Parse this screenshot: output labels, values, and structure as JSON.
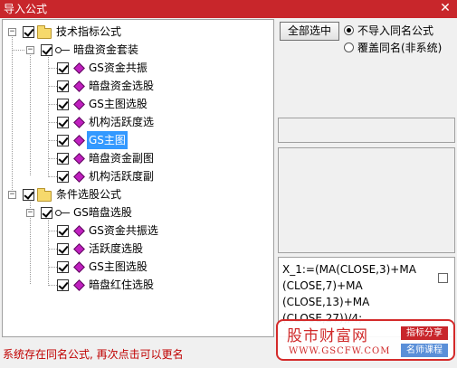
{
  "window": {
    "title": "导入公式",
    "close_glyph": "✕"
  },
  "tree": {
    "groups": [
      {
        "label": "技术指标公式",
        "expander": "−",
        "sets": [
          {
            "label": "暗盘资金套装",
            "expander": "−",
            "items": [
              "GS资金共振",
              "暗盘资金选股",
              "GS主图选股",
              "机构活跃度选",
              "GS主图",
              "暗盘资金副图",
              "机构活跃度副"
            ]
          }
        ]
      },
      {
        "label": "条件选股公式",
        "expander": "−",
        "sets": [
          {
            "label": "GS暗盘选股",
            "expander": "−",
            "items": [
              "GS资金共振选",
              "活跃度选股",
              "GS主图选股",
              "暗盘红住选股"
            ]
          }
        ]
      }
    ],
    "selected_item": "GS主图"
  },
  "controls": {
    "select_all_label": "全部选中",
    "radio_options": [
      {
        "label": "不导入同名公式",
        "checked": true
      },
      {
        "label": "覆盖同名(非系统)",
        "checked": false
      }
    ]
  },
  "formula_text": "X_1:=(MA(CLOSE,3)+MA\n(CLOSE,7)+MA\n(CLOSE,13)+MA\n(CLOSE,27))/4;",
  "status_message": "系统存在同名公式, 再次点击可以更名",
  "watermark": {
    "brand": "股市财富网",
    "site": "WWW.GSCFW.COM",
    "tag1": "指标分享",
    "tag2": "名师课程"
  },
  "colors": {
    "titlebar": "#c8262b",
    "selection": "#3399ff",
    "status_text": "#c00000",
    "gem": "#c01fbf",
    "folder": "#f6d96c"
  }
}
